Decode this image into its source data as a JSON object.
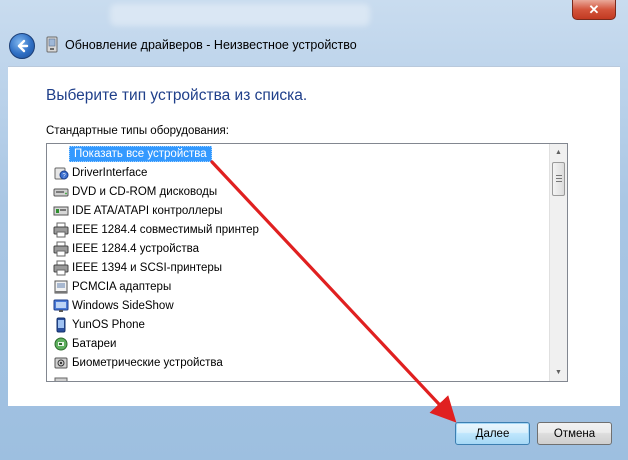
{
  "window": {
    "title": "Обновление драйверов - Неизвестное устройство",
    "close_label": "✕"
  },
  "content": {
    "heading": "Выберите тип устройства из списка.",
    "list_label": "Стандартные типы оборудования:",
    "items": [
      {
        "label": "Показать все устройства",
        "icon": "none",
        "selected": true
      },
      {
        "label": "DriverInterface",
        "icon": "unknown-device-icon"
      },
      {
        "label": "DVD и CD-ROM дисководы",
        "icon": "dvd-drive-icon"
      },
      {
        "label": "IDE ATA/ATAPI контроллеры",
        "icon": "ide-controller-icon"
      },
      {
        "label": "IEEE 1284.4 совместимый принтер",
        "icon": "printer-icon"
      },
      {
        "label": "IEEE 1284.4 устройства",
        "icon": "printer-icon"
      },
      {
        "label": "IEEE 1394 и SCSI-принтеры",
        "icon": "printer-icon"
      },
      {
        "label": "PCMCIA адаптеры",
        "icon": "pcmcia-card-icon"
      },
      {
        "label": "Windows SideShow",
        "icon": "sideshow-icon"
      },
      {
        "label": "YunOS Phone",
        "icon": "phone-icon"
      },
      {
        "label": "Батареи",
        "icon": "battery-icon"
      },
      {
        "label": "Биометрические устройства",
        "icon": "biometric-icon"
      },
      {
        "label": "",
        "icon": "partial-icon"
      }
    ]
  },
  "footer": {
    "next_label": "Далее",
    "cancel_label": "Отмена"
  },
  "colors": {
    "heading": "#1f3f8a",
    "selection": "#3399ff",
    "annotation_arrow": "#e02020"
  }
}
